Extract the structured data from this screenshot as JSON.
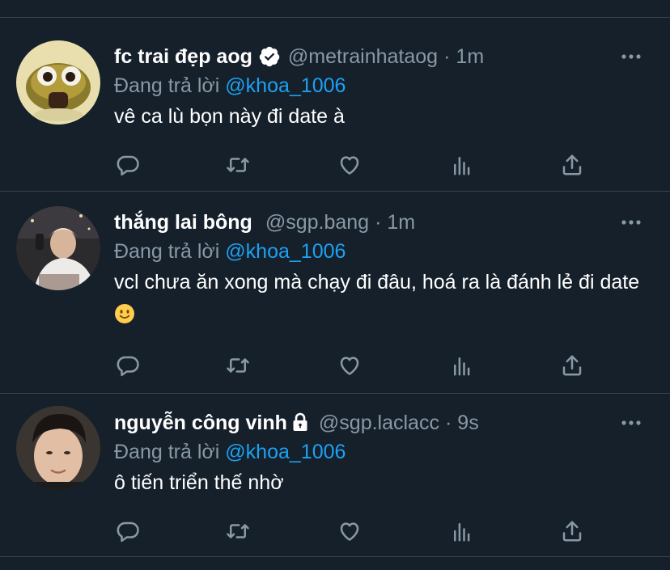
{
  "reply_prefix": "Đang trả lời",
  "tweets": [
    {
      "display_name": "fc trai đẹp aog",
      "handle": "@metrainhataog",
      "separator": "·",
      "time": "1m",
      "reply_to": "@khoa_1006",
      "text": "vê ca lù bọn này đi date à",
      "badge": "verified-icon"
    },
    {
      "display_name": "thắng lai bông",
      "handle": "@sgp.bang",
      "separator": "·",
      "time": "1m",
      "reply_to": "@khoa_1006",
      "text": "vcl chưa ăn xong mà chạy đi đâu, hoá ra là đánh lẻ đi date",
      "emoji": "slightly-smiling-face-emoji"
    },
    {
      "display_name": "nguyễn công vinh",
      "handle": "@sgp.laclacc",
      "separator": "·",
      "time": "9s",
      "reply_to": "@khoa_1006",
      "text": "ô tiến triển thế nhờ",
      "badge": "lock-icon"
    }
  ],
  "colors": {
    "background": "#15202b",
    "divider": "#38444d",
    "secondary_text": "#8899a6",
    "link": "#1da1f2",
    "primary_text": "#ffffff"
  },
  "icons": [
    "reply-icon",
    "retweet-icon",
    "like-icon",
    "analytics-icon",
    "share-icon",
    "more-icon"
  ]
}
